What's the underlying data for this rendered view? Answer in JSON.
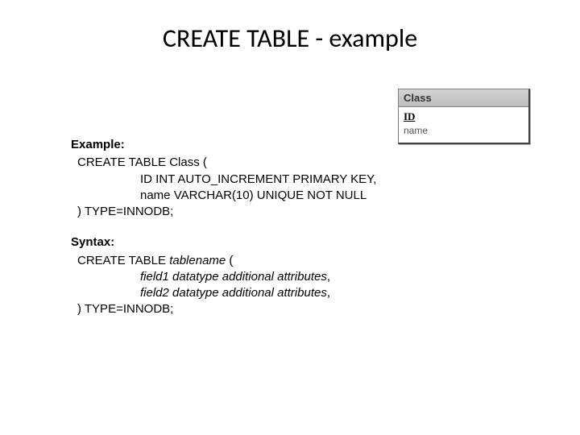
{
  "title": "CREATE TABLE - example",
  "example": {
    "label": "Example:",
    "line1": "CREATE TABLE  Class (",
    "line2": "ID INT AUTO_INCREMENT PRIMARY KEY,",
    "line3": "name VARCHAR(10) UNIQUE NOT NULL",
    "line4": ") TYPE=INNODB;"
  },
  "syntax": {
    "label": "Syntax:",
    "line1_a": "CREATE TABLE  ",
    "line1_b": "tablename",
    "line1_c": " (",
    "line2_a": "field1 datatype additional attributes",
    "line2_b": ",",
    "line3_a": "field2 datatype additional attributes",
    "line3_b": ",",
    "line4": ") TYPE=INNODB;"
  },
  "table_widget": {
    "header": "Class",
    "pk": "ID",
    "field": "name"
  }
}
